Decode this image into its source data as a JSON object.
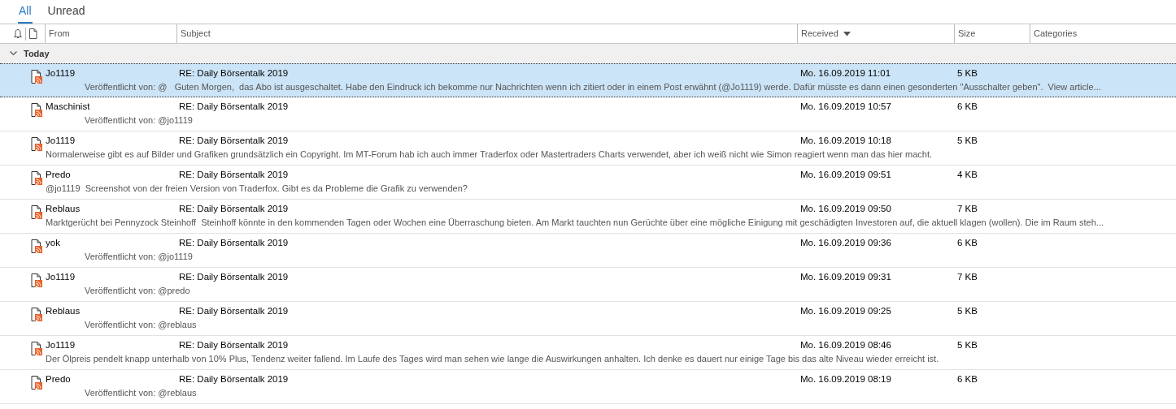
{
  "tabs": [
    {
      "label": "All",
      "selected": true
    },
    {
      "label": "Unread",
      "selected": false
    }
  ],
  "columns": {
    "from": "From",
    "subject": "Subject",
    "received": "Received",
    "size": "Size",
    "categories": "Categories"
  },
  "group": {
    "label": "Today",
    "expanded": true
  },
  "messages": [
    {
      "kind": "byline",
      "from": "Jo1119",
      "subject": "RE: Daily Börsentalk 2019",
      "received": "Mo. 16.09.2019 11:01",
      "size": "5 KB",
      "preview": "Veröffentlicht von: @   Guten Morgen,  das Abo ist ausgeschaltet. Habe den Eindruck ich bekomme nur Nachrichten wenn ich zitiert oder in einem Post erwähnt (@Jo1119) werde. Dafür müsste es dann einen gesonderten \"Ausschalter geben\".  View article...",
      "selected": true
    },
    {
      "kind": "byline",
      "from": "Maschinist",
      "subject": "RE: Daily Börsentalk 2019",
      "received": "Mo. 16.09.2019 10:57",
      "size": "6 KB",
      "preview": "Veröffentlicht von: @jo1119",
      "selected": false
    },
    {
      "kind": "excerpt",
      "from": "Jo1119",
      "subject": "RE: Daily Börsentalk 2019",
      "received": "Mo. 16.09.2019 10:18",
      "size": "5 KB",
      "preview": "Normalerweise gibt es auf Bilder und Grafiken grundsätzlich ein Copyright. Im MT-Forum hab ich auch immer Traderfox oder Mastertraders Charts verwendet, aber ich weiß nicht wie Simon reagiert wenn man das hier macht.",
      "selected": false
    },
    {
      "kind": "excerpt",
      "from": "Predo",
      "subject": "RE: Daily Börsentalk 2019",
      "received": "Mo. 16.09.2019 09:51",
      "size": "4 KB",
      "preview": "@jo1119  Screenshot von der freien Version von Traderfox. Gibt es da Probleme die Grafik zu verwenden?",
      "selected": false
    },
    {
      "kind": "excerpt",
      "from": "Reblaus",
      "subject": "RE: Daily Börsentalk 2019",
      "received": "Mo. 16.09.2019 09:50",
      "size": "7 KB",
      "preview": "Marktgerücht bei Pennyzock Steinhoff  Steinhoff könnte in den kommenden Tagen oder Wochen eine Überraschung bieten. Am Markt tauchten nun Gerüchte über eine mögliche Einigung mit geschädigten Investoren auf, die aktuell klagen (wollen). Die im Raum steh...",
      "selected": false
    },
    {
      "kind": "byline",
      "from": "yok",
      "subject": "RE: Daily Börsentalk 2019",
      "received": "Mo. 16.09.2019 09:36",
      "size": "6 KB",
      "preview": "Veröffentlicht von: @jo1119",
      "selected": false
    },
    {
      "kind": "byline",
      "from": "Jo1119",
      "subject": "RE: Daily Börsentalk 2019",
      "received": "Mo. 16.09.2019 09:31",
      "size": "7 KB",
      "preview": "Veröffentlicht von: @predo",
      "selected": false
    },
    {
      "kind": "byline",
      "from": "Reblaus",
      "subject": "RE: Daily Börsentalk 2019",
      "received": "Mo. 16.09.2019 09:25",
      "size": "5 KB",
      "preview": "Veröffentlicht von: @reblaus",
      "selected": false
    },
    {
      "kind": "excerpt",
      "from": "Jo1119",
      "subject": "RE: Daily Börsentalk 2019",
      "received": "Mo. 16.09.2019 08:46",
      "size": "5 KB",
      "preview": "Der Ölpreis pendelt knapp unterhalb von 10% Plus, Tendenz weiter fallend. Im Laufe des Tages wird man sehen wie lange die Auswirkungen anhalten. Ich denke es dauert nur einige Tage bis das alte Niveau wieder erreicht ist.",
      "selected": false
    },
    {
      "kind": "byline",
      "from": "Predo",
      "subject": "RE: Daily Börsentalk 2019",
      "received": "Mo. 16.09.2019 08:19",
      "size": "6 KB",
      "preview": "Veröffentlicht von: @reblaus",
      "selected": false
    }
  ]
}
